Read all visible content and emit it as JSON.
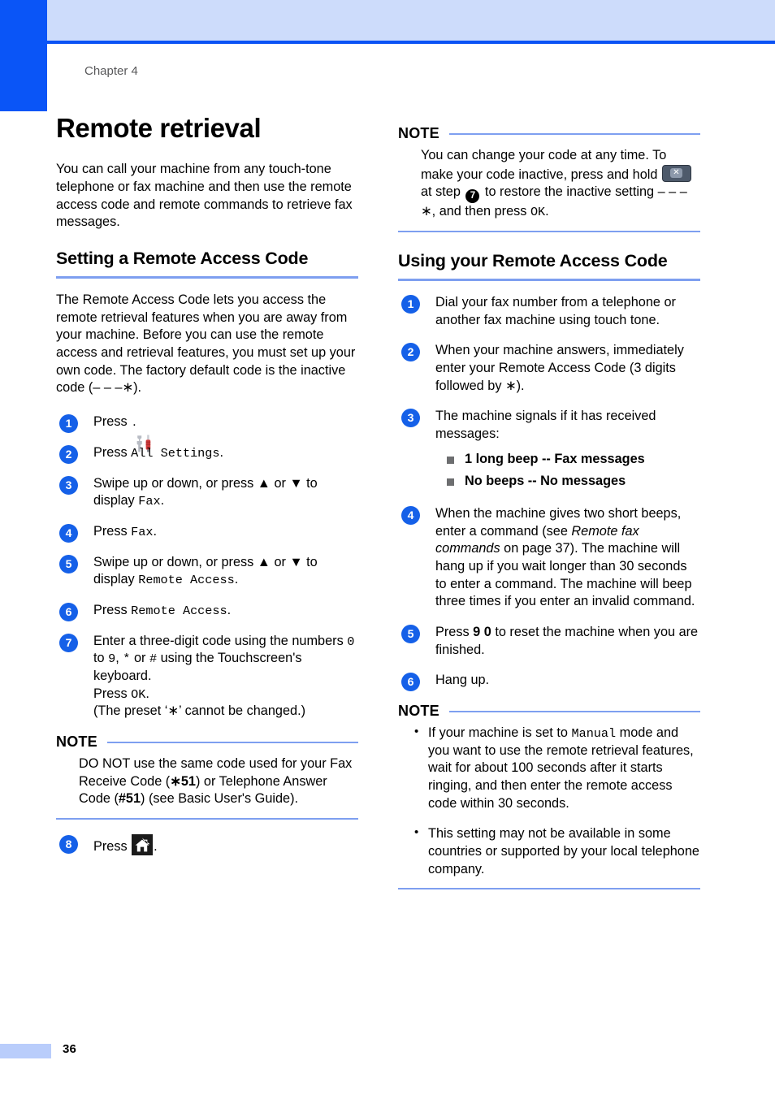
{
  "page": {
    "chapter_label": "Chapter 4",
    "page_number": "36",
    "title": "Remote retrieval",
    "intro": "You can call your machine from any touch-tone telephone or fax machine and then use the remote access code and remote commands to retrieve fax messages."
  },
  "colors": {
    "tab_blue": "#0a55f7",
    "header_band": "#cddcfb",
    "header_rule": "#0a52f5",
    "rule_blue": "#7e9ff0",
    "step_circle": "#1560e8",
    "bullet_gray": "#6d6e70",
    "icon_dark": "#363a42"
  },
  "left_column": {
    "section": {
      "heading": "Setting a Remote Access Code",
      "body": "The Remote Access Code lets you access the remote retrieval features when you are away from your machine. Before you can use the remote access and retrieval features, you must set up your own code. The factory default code is the inactive code (– – –∗)."
    },
    "steps": [
      {
        "num": "1",
        "pre": "Press ",
        "icon": "settings-icon",
        "post": "."
      },
      {
        "num": "2",
        "pre": "Press ",
        "mono": "All Settings",
        "post": "."
      },
      {
        "num": "3",
        "pre": "Swipe up or down, or press ▲ or ▼ to display ",
        "mono": "Fax",
        "post": "."
      },
      {
        "num": "4",
        "pre": "Press ",
        "mono": "Fax",
        "post": "."
      },
      {
        "num": "5",
        "pre": "Swipe up or down, or press ▲ or ▼ to display ",
        "mono": "Remote Access",
        "post": "."
      },
      {
        "num": "6",
        "pre": "Press ",
        "mono": "Remote Access",
        "post": "."
      }
    ],
    "step7": {
      "num": "7",
      "line1_a": "Enter a three-digit code using the numbers ",
      "line1_m1": "0",
      "line1_b": " to ",
      "line1_m2": "9",
      "line1_c": ", ",
      "line1_m3": "*",
      "line1_d": " or ",
      "line1_m4": "#",
      "line1_e": " using the Touchscreen's keyboard.",
      "line2_a": "Press ",
      "line2_m": "OK",
      "line2_b": ".",
      "line3": "(The preset ‘∗’ cannot be changed.)"
    },
    "note": {
      "label": "NOTE",
      "text_a": "DO NOT use the same code used for your Fax Receive Code (",
      "bold_a": "∗51",
      "text_b": ") or Telephone Answer Code (",
      "bold_b": "#51",
      "text_c": ") (see Basic User's Guide)."
    },
    "step8": {
      "num": "8",
      "pre": "Press ",
      "icon": "home-icon",
      "post": "."
    }
  },
  "right_column": {
    "note_top": {
      "label": "NOTE",
      "text_a": "You can change your code at any time. To make your code inactive, press and hold ",
      "icon": "clear-icon",
      "text_b": " at step ",
      "badge": "7",
      "text_c": " to restore the inactive setting – – –∗, and then press ",
      "mono": "OK",
      "text_d": "."
    },
    "section": {
      "heading": "Using your Remote Access Code"
    },
    "steps": [
      {
        "num": "1",
        "text": "Dial your fax number from a telephone or another fax machine using touch tone."
      },
      {
        "num": "2",
        "text": "When your machine answers, immediately enter your Remote Access Code (3 digits followed by ∗)."
      },
      {
        "num": "3",
        "text": "The machine signals if it has received messages:",
        "bullets": [
          "1 long beep -- Fax messages",
          "No beeps -- No messages"
        ]
      },
      {
        "num": "4",
        "text_a": "When the machine gives two short beeps, enter a command (see ",
        "italic": "Remote fax commands",
        "text_b": " on page 37). The machine will hang up if you wait longer than 30 seconds to enter a command. The machine will beep three times if you enter an invalid command."
      },
      {
        "num": "5",
        "text_a": "Press ",
        "bold": "9 0",
        "text_b": " to reset the machine when you are finished."
      },
      {
        "num": "6",
        "text": "Hang up."
      }
    ],
    "note_bottom": {
      "label": "NOTE",
      "bullet1_a": "If your machine is set to ",
      "bullet1_m": "Manual",
      "bullet1_b": " mode and you want to use the remote retrieval features, wait for about 100 seconds after it starts ringing, and then enter the remote access code within 30 seconds.",
      "bullet2": "This setting may not be available in some countries or supported by your local telephone company."
    }
  }
}
